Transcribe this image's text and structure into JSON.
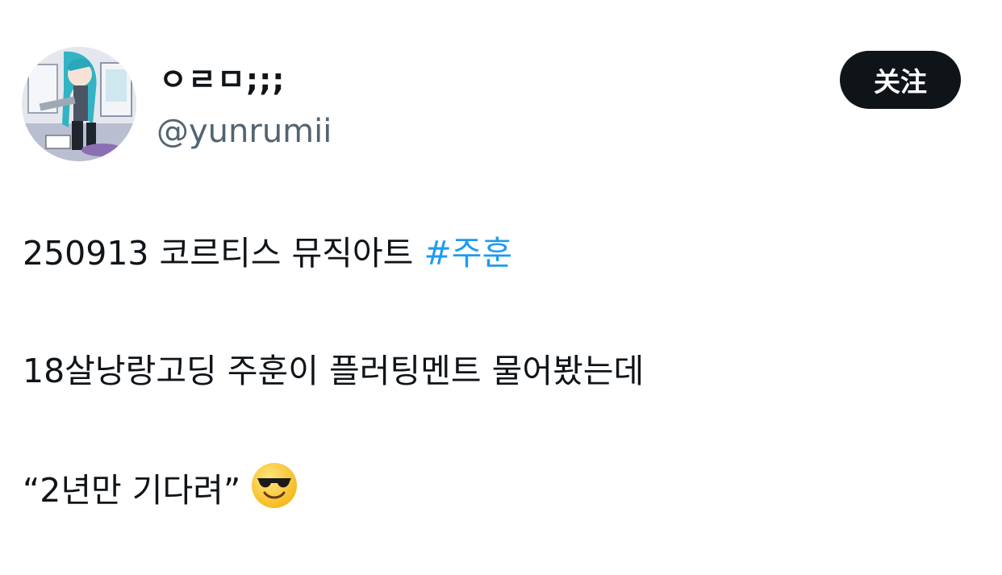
{
  "tweet": {
    "author": {
      "display_name": "ㅇㄹㅁ;;;",
      "handle": "@yunrumii",
      "avatar_icon": "profile-avatar-anime-character"
    },
    "follow_button_label": "关注",
    "text_lines": {
      "line1_prefix": "250913 코르티스 뮤직아트 ",
      "line1_hashtag": "#주훈",
      "line2": "18살낭랑고딩 주훈이 플러팅멘트 물어봤는데",
      "line3": "“2년만 기다려”"
    },
    "emoji": "smiling-face-with-sunglasses-icon"
  },
  "colors": {
    "text": "#0f1419",
    "secondary_text": "#536471",
    "hashtag": "#1d9bf0",
    "button_bg": "#0f1419",
    "button_text": "#ffffff"
  }
}
